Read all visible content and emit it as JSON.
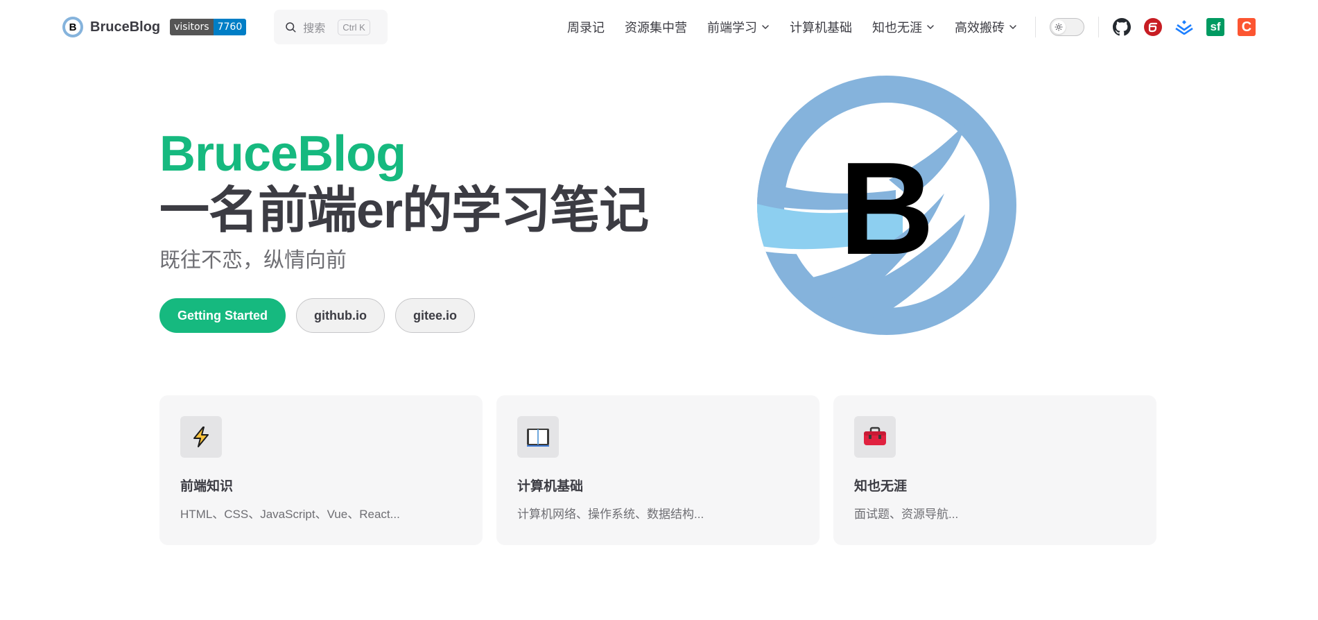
{
  "nav": {
    "brand_title": "BruceBlog",
    "brand_logo_letter": "B",
    "visitors_label": "visitors",
    "visitors_count": "7760",
    "search_placeholder": "搜索",
    "search_shortcut": "Ctrl K",
    "links": [
      {
        "label": "周录记",
        "dropdown": false
      },
      {
        "label": "资源集中营",
        "dropdown": false
      },
      {
        "label": "前端学习",
        "dropdown": true
      },
      {
        "label": "计算机基础",
        "dropdown": false
      },
      {
        "label": "知也无涯",
        "dropdown": true
      },
      {
        "label": "高效搬砖",
        "dropdown": true
      }
    ],
    "social": [
      {
        "icon": "github-icon",
        "color": "#24292f"
      },
      {
        "icon": "gitee-icon",
        "color": "#c71d23",
        "glyph": "G"
      },
      {
        "icon": "juejin-icon",
        "color": "#1e80ff"
      },
      {
        "icon": "segmentfault-icon",
        "color": "#009a61",
        "glyph": "sf"
      },
      {
        "icon": "csdn-icon",
        "color": "#fc5531",
        "glyph": "C"
      }
    ]
  },
  "hero": {
    "name": "BruceBlog",
    "text": "一名前端er的学习笔记",
    "tagline": "既往不恋，纵情向前",
    "logo_letter": "B",
    "actions": [
      {
        "label": "Getting Started",
        "theme": "brand"
      },
      {
        "label": "github.io",
        "theme": "alt"
      },
      {
        "label": "gitee.io",
        "theme": "alt"
      }
    ]
  },
  "features": [
    {
      "icon": "lightning-icon",
      "title": "前端知识",
      "details": "HTML、CSS、JavaScript、Vue、React..."
    },
    {
      "icon": "book-icon",
      "title": "计算机基础",
      "details": "计算机网络、操作系统、数据结构..."
    },
    {
      "icon": "toolbox-icon",
      "title": "知也无涯",
      "details": "面试题、资源导航..."
    }
  ],
  "colors": {
    "brand": "#16b97f",
    "text": "#3c3c43",
    "logo_blue": "#85b3dc",
    "logo_light_blue": "#8dcff0"
  }
}
